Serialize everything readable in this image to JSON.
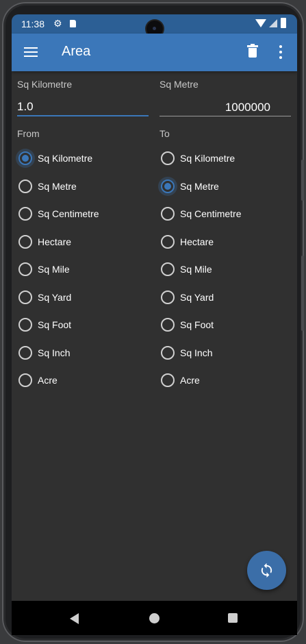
{
  "status_bar": {
    "time": "11:38",
    "icons": [
      "gear-icon",
      "sd-card-icon",
      "wifi-icon",
      "signal-icon",
      "battery-icon"
    ]
  },
  "app_bar": {
    "title": "Area",
    "menu_icon": "menu-icon",
    "delete_icon": "trash-icon",
    "more_icon": "more-vert-icon"
  },
  "from": {
    "unit_label": "Sq Kilometre",
    "value": "1.0",
    "group_label": "From",
    "selected": "Sq Kilometre",
    "options": [
      "Sq Kilometre",
      "Sq Metre",
      "Sq Centimetre",
      "Hectare",
      "Sq Mile",
      "Sq Yard",
      "Sq Foot",
      "Sq Inch",
      "Acre"
    ]
  },
  "to": {
    "unit_label": "Sq Metre",
    "value": "1000000",
    "group_label": "To",
    "selected": "Sq Metre",
    "options": [
      "Sq Kilometre",
      "Sq Metre",
      "Sq Centimetre",
      "Hectare",
      "Sq Mile",
      "Sq Yard",
      "Sq Foot",
      "Sq Inch",
      "Acre"
    ]
  },
  "fab": {
    "icon": "swap-icon"
  },
  "nav_bar": {
    "icons": [
      "back-icon",
      "home-icon",
      "recents-icon"
    ]
  },
  "colors": {
    "primary": "#3b77b9",
    "status_bar": "#2c5f95",
    "background": "#303030",
    "fab": "#3b6ea8"
  }
}
